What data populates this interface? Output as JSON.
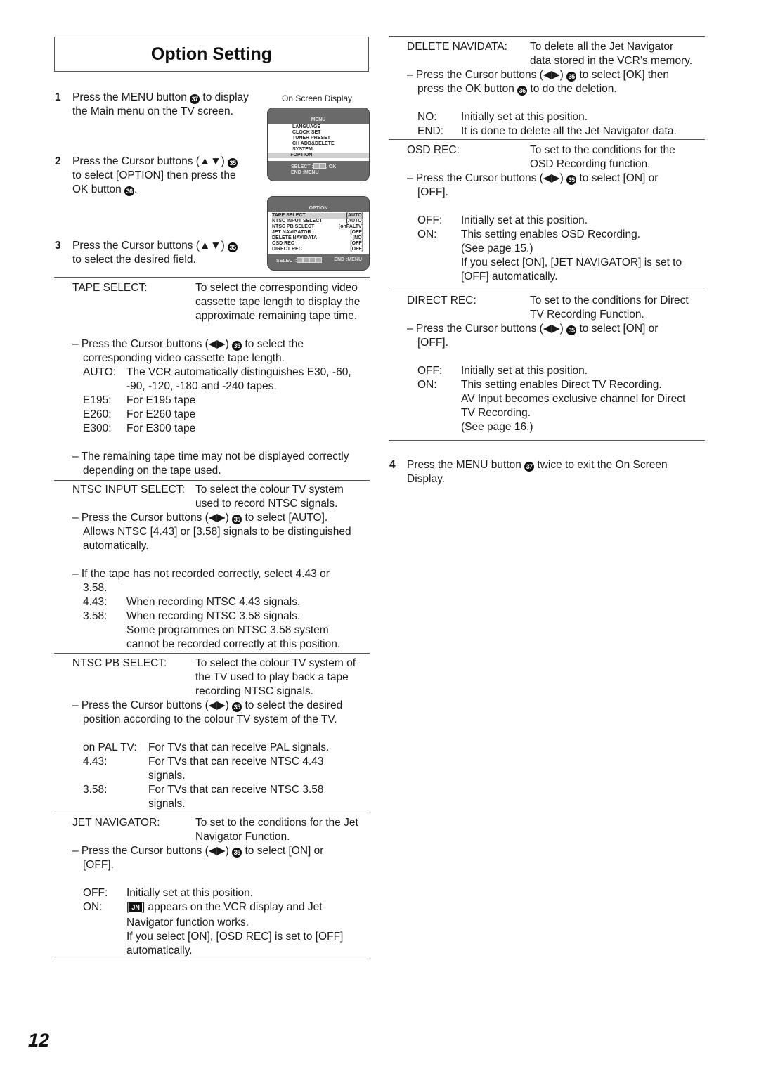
{
  "title": "Option Setting",
  "page_number": "12",
  "steps": {
    "s1": {
      "num": "1",
      "l1a": "Press the MENU button ",
      "l1b": " to display",
      "l2": "the Main menu on the TV screen.",
      "btn": "37"
    },
    "s2": {
      "num": "2",
      "l1a": "Press the Cursor buttons (▲▼) ",
      "btn1": "35",
      "l2": "to select [OPTION] then press the",
      "l3a": "OK button ",
      "btn2": "36",
      "l3b": "."
    },
    "s3": {
      "num": "3",
      "l1a": "Press the Cursor buttons (▲▼) ",
      "btn": "35",
      "l2": "to select the desired field."
    },
    "s4": {
      "num": "4",
      "l1a": "Press the MENU button ",
      "btn": "37",
      "l1b": " twice to exit the On Screen",
      "l2": "Display."
    }
  },
  "osd_label": "On Screen Display",
  "menu_screen": {
    "title": "MENU",
    "items": [
      "LANGUAGE",
      "CLOCK SET",
      "TUNER PRESET",
      "CH ADD&DELETE",
      "SYSTEM",
      "▸OPTION"
    ],
    "selected": "OPTION",
    "footer1": "SELECT :",
    "footer1b": ", OK",
    "footer2": "END       :MENU"
  },
  "option_screen": {
    "title": "OPTION",
    "rows": [
      {
        "name": "TAPE SELECT",
        "value": "[AUTO]"
      },
      {
        "name": "NTSC INPUT SELECT",
        "value": "[AUTO]"
      },
      {
        "name": "NTSC PB SELECT",
        "value": "[onPALTV]"
      },
      {
        "name": "JET NAVIGATOR",
        "value": "[OFF]"
      },
      {
        "name": "DELETE NAVIDATA",
        "value": "[NO]"
      },
      {
        "name": "OSD REC",
        "value": "[OFF]"
      },
      {
        "name": "DIRECT REC",
        "value": "[OFF]"
      }
    ],
    "footer_left": "SELECT:",
    "footer_right": "END :MENU"
  },
  "left": {
    "tape": {
      "label": "TAPE SELECT:",
      "desc": [
        "To select the corresponding video",
        "cassette tape length to display the",
        "approximate remaining tape time."
      ],
      "press_a": "– Press the Cursor buttons (◀▶) ",
      "press_b": " to select the",
      "btn": "35",
      "press2": "corresponding video cassette tape length.",
      "opts": [
        {
          "k": "AUTO:",
          "v": "The VCR automatically distinguishes E30, -60,"
        },
        {
          "k": "",
          "v": "-90, -120, -180 and -240 tapes."
        },
        {
          "k": "E195:",
          "v": "For E195 tape"
        },
        {
          "k": "E260:",
          "v": "For E260 tape"
        },
        {
          "k": "E300:",
          "v": "For E300 tape"
        }
      ],
      "note1": "– The remaining tape time may not be displayed correctly",
      "note2": "depending on the tape used."
    },
    "ntsc_in": {
      "label": "NTSC INPUT SELECT:",
      "desc": [
        "To select the colour TV system",
        "used to record NTSC signals."
      ],
      "press_a": "– Press the Cursor buttons (◀▶) ",
      "press_b": " to select [AUTO].",
      "btn": "35",
      "l2": "Allows NTSC [4.43] or [3.58] signals to be distinguished",
      "l3": "automatically.",
      "if1": "– If the tape has not recorded correctly, select 4.43 or",
      "if2": "3.58.",
      "opts": [
        {
          "k": "4.43:",
          "v": "When recording NTSC 4.43 signals."
        },
        {
          "k": "3.58:",
          "v": "When recording NTSC 3.58 signals."
        },
        {
          "k": "",
          "v": "Some programmes on NTSC 3.58 system"
        },
        {
          "k": "",
          "v": "cannot be recorded correctly at this position."
        }
      ]
    },
    "ntsc_pb": {
      "label": "NTSC PB SELECT:",
      "desc": [
        "To select the colour TV system of",
        "the TV used to play back a tape",
        "recording NTSC signals."
      ],
      "press_a": "– Press the Cursor buttons (◀▶) ",
      "press_b": " to select the desired",
      "btn": "35",
      "l2": "position according to the colour TV system of the TV.",
      "opts": [
        {
          "k": "on PAL TV:",
          "v": "For TVs that can receive PAL signals."
        },
        {
          "k": "4.43:",
          "v": "For TVs that can receive NTSC 4.43"
        },
        {
          "k": "",
          "v": "signals."
        },
        {
          "k": "3.58:",
          "v": "For TVs that can receive NTSC 3.58"
        },
        {
          "k": "",
          "v": "signals."
        }
      ]
    },
    "jet": {
      "label": "JET NAVIGATOR:",
      "desc": [
        "To set to the conditions for the Jet",
        "Navigator Function."
      ],
      "press_a": "– Press the Cursor buttons (◀▶) ",
      "press_b": " to select [ON] or",
      "btn": "35",
      "l2": "[OFF].",
      "off_k": "OFF:",
      "off_v": "Initially set at this position.",
      "on_k": "ON:",
      "on_icon": "JN",
      "on_v": " appears on the VCR display and Jet",
      "on_l2": "Navigator function works.",
      "on_l3": "If you select [ON], [OSD REC] is set to [OFF]",
      "on_l4": "automatically."
    }
  },
  "right": {
    "del": {
      "label": "DELETE NAVIDATA:",
      "desc": [
        "To delete all the Jet Navigator",
        "data stored in the VCR’s memory."
      ],
      "press_a": "– Press the Cursor buttons (◀▶) ",
      "press_b": " to select [OK] then",
      "btn": "35",
      "l2a": "press the OK button ",
      "btn2": "36",
      "l2b": " to do the deletion.",
      "opts": [
        {
          "k": "NO:",
          "v": "Initially set at this position."
        },
        {
          "k": "END:",
          "v": "It is done to delete all the Jet Navigator data."
        }
      ]
    },
    "osd": {
      "label": "OSD REC:",
      "desc": [
        "To set to the conditions for the",
        "OSD Recording function."
      ],
      "press_a": "– Press the Cursor buttons (◀▶) ",
      "press_b": " to select [ON] or",
      "btn": "35",
      "l2": "[OFF].",
      "opts": [
        {
          "k": "OFF:",
          "v": "Initially set at this position."
        },
        {
          "k": "ON:",
          "v": "This setting enables OSD Recording."
        },
        {
          "k": "",
          "v": "(See page 15.)"
        },
        {
          "k": "",
          "v": "If you select [ON], [JET NAVIGATOR] is set to"
        },
        {
          "k": "",
          "v": "[OFF] automatically."
        }
      ]
    },
    "direct": {
      "label": "DIRECT REC:",
      "desc": [
        "To set to the conditions for Direct",
        "TV Recording Function."
      ],
      "press_a": "– Press the Cursor buttons (◀▶) ",
      "press_b": " to select [ON] or",
      "btn": "35",
      "l2": "[OFF].",
      "opts": [
        {
          "k": "OFF:",
          "v": "Initially set at this position."
        },
        {
          "k": "ON:",
          "v": "This setting enables Direct TV Recording."
        },
        {
          "k": "",
          "v": "AV Input  becomes exclusive channel for Direct"
        },
        {
          "k": "",
          "v": "TV Recording."
        },
        {
          "k": "",
          "v": "(See page 16.)"
        }
      ]
    }
  }
}
